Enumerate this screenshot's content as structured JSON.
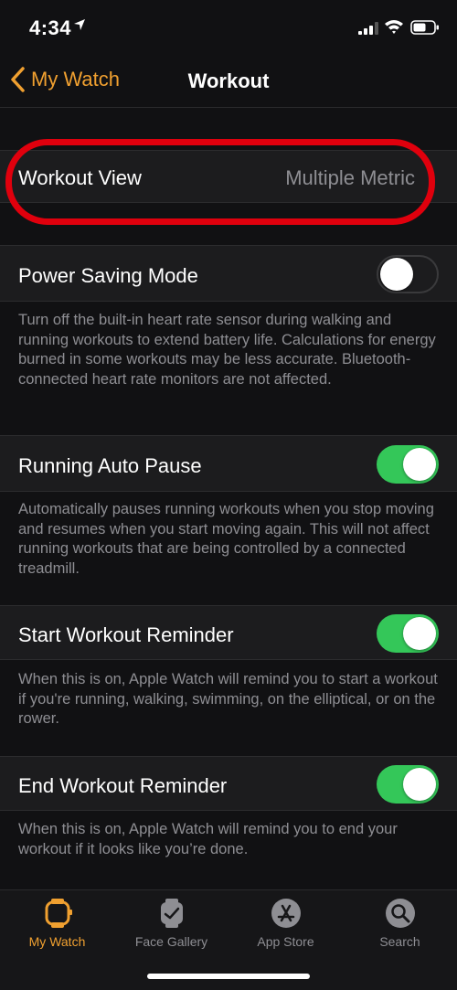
{
  "status": {
    "time": "4:34"
  },
  "nav": {
    "back_label": "My Watch",
    "title": "Workout"
  },
  "workout_view": {
    "label": "Workout View",
    "value": "Multiple Metric"
  },
  "settings": [
    {
      "label": "Power Saving Mode",
      "enabled": false,
      "desc": "Turn off the built-in heart rate sensor during walking and running workouts to extend battery life. Calculations for energy burned in some workouts may be less accurate. Bluetooth-connected heart rate monitors are not affected."
    },
    {
      "label": "Running Auto Pause",
      "enabled": true,
      "desc": "Automatically pauses running workouts when you stop moving and resumes when you start moving again. This will not affect running workouts that are being controlled by a connected treadmill."
    },
    {
      "label": "Start Workout Reminder",
      "enabled": true,
      "desc": "When this is on, Apple Watch will remind you to start a workout if you're running, walking, swimming, on the elliptical, or on the rower."
    },
    {
      "label": "End Workout Reminder",
      "enabled": true,
      "desc": "When this is on, Apple Watch will remind you to end your workout if it looks like you’re done."
    }
  ],
  "tabs": [
    {
      "label": "My Watch",
      "icon": "watch-icon",
      "active": true
    },
    {
      "label": "Face Gallery",
      "icon": "face-gallery-icon",
      "active": false
    },
    {
      "label": "App Store",
      "icon": "app-store-icon",
      "active": false
    },
    {
      "label": "Search",
      "icon": "search-icon",
      "active": false
    }
  ],
  "colors": {
    "accent": "#f0a030",
    "toggle_on": "#34c759",
    "highlight": "#e0000d"
  }
}
